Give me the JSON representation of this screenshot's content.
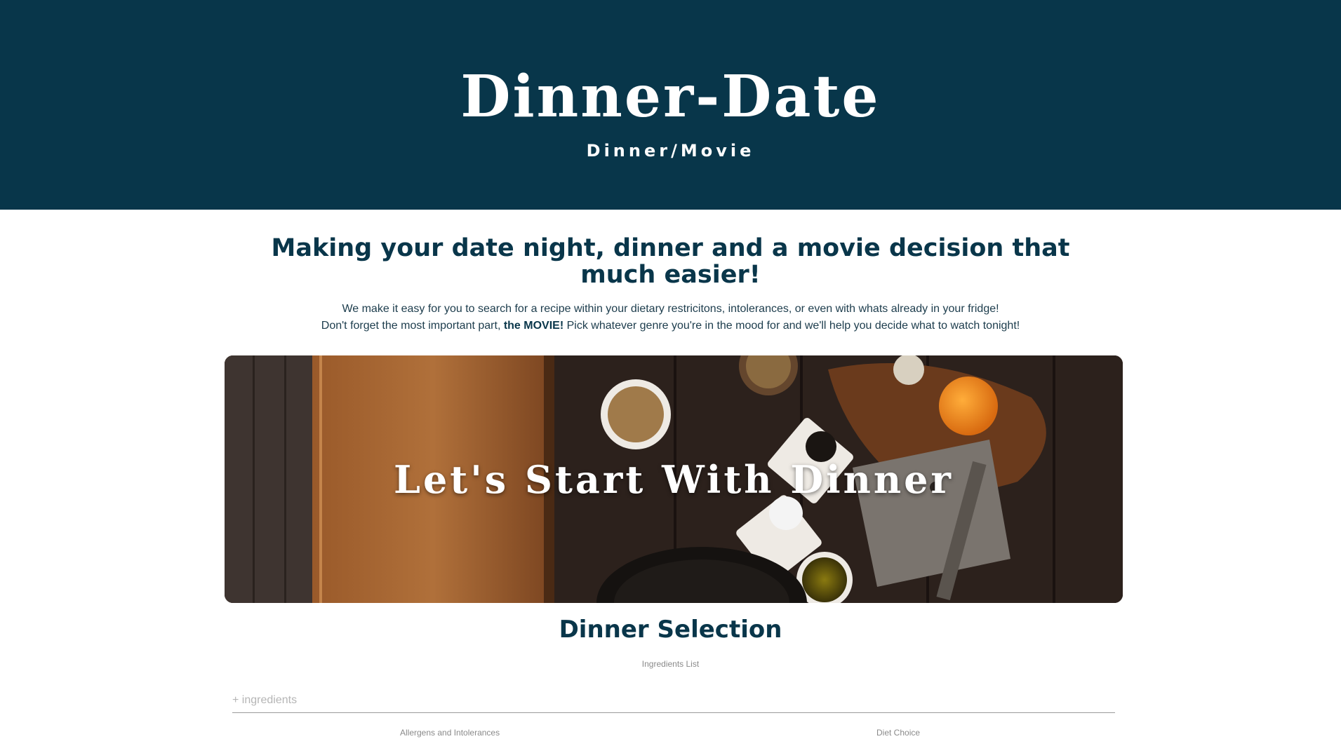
{
  "header": {
    "title": "Dinner-Date",
    "subtitle": "Dinner/Movie",
    "background_color": "#08364a"
  },
  "intro": {
    "heading": "Making your date night, dinner and a movie decision that much easier!",
    "line1": "We make it easy for you to search for a recipe within your dietary restricitons, intolerances, or even with whats already in your fridge!",
    "line2_before": "Don't forget the most important part, ",
    "line2_bold": "the MOVIE!",
    "line2_after": " Pick whatever genre you're in the mood for and we'll help you decide what to watch tonight!"
  },
  "banner": {
    "text": "Let's Start With Dinner"
  },
  "dinner": {
    "title": "Dinner Selection",
    "ingredients_label": "Ingredients List",
    "ingredients_placeholder": "+ ingredients",
    "allergens_label": "Allergens and Intolerances",
    "diet_label": "Diet Choice"
  }
}
